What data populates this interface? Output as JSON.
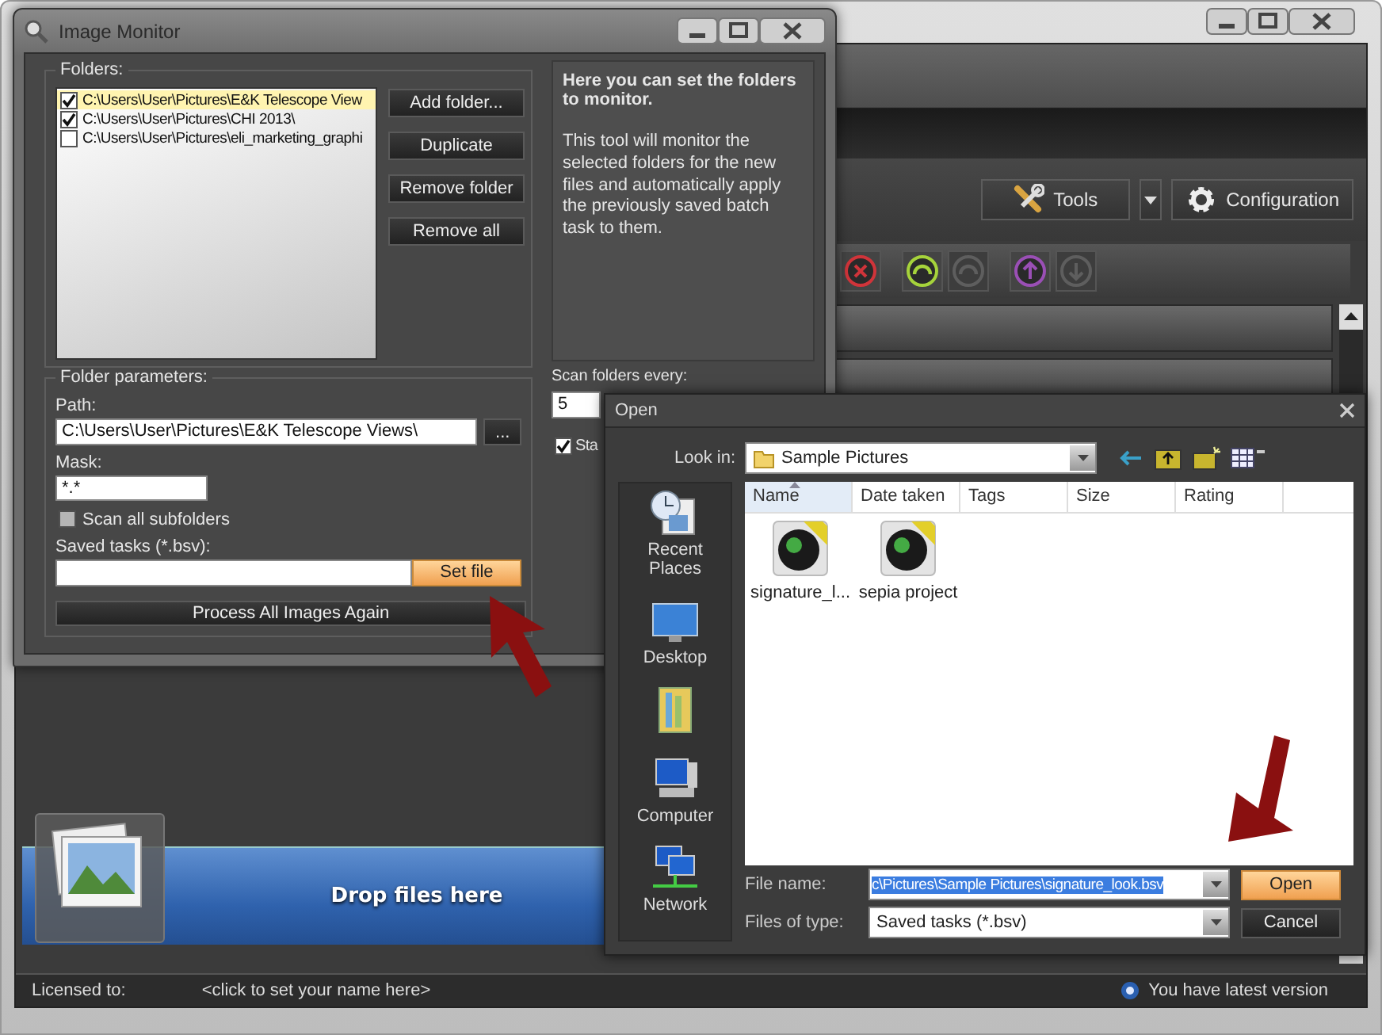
{
  "main_window": {
    "toolbar_buttons": [
      {
        "label": "Tools",
        "kind": "tools"
      },
      {
        "label": "Configuration",
        "kind": "configuration"
      }
    ],
    "action_buttons": [
      {
        "kind": "cancel",
        "disabled": false
      },
      {
        "kind": "up",
        "disabled": false
      },
      {
        "kind": "up",
        "disabled": true
      },
      {
        "kind": "upload",
        "disabled": false
      },
      {
        "kind": "download",
        "disabled": true
      }
    ],
    "drop_zone": {
      "label": "Drop files here"
    },
    "status_bar": {
      "license_label": "Licensed to:",
      "license_value": "<click to set your name here>",
      "update_status": "You have latest version"
    }
  },
  "image_monitor": {
    "title": "Image Monitor",
    "folders_label": "Folders:",
    "folders": [
      {
        "path": "C:\\Users\\User\\Pictures\\E&K Telescope View",
        "checked": true,
        "selected": true
      },
      {
        "path": "C:\\Users\\User\\Pictures\\CHI 2013\\",
        "checked": true,
        "selected": false
      },
      {
        "path": "C:\\Users\\User\\Pictures\\eli_marketing_graphi",
        "checked": false,
        "selected": false
      }
    ],
    "folder_buttons": [
      "Add folder...",
      "Duplicate",
      "Remove folder",
      "Remove all"
    ],
    "info_title": "Here you can set the folders to monitor.",
    "info_text": "This tool will monitor the selected folders for the new files and automatically apply the previously saved batch task to them.",
    "params_label": "Folder parameters:",
    "path_label": "Path:",
    "path_value": "C:\\Users\\User\\Pictures\\E&K Telescope Views\\",
    "browse_button": "...",
    "mask_label": "Mask:",
    "mask_value": "*.*",
    "scan_subfolders": {
      "label": "Scan all subfolders",
      "checked": false
    },
    "saved_tasks_label": "Saved tasks (*.bsv):",
    "set_file_button": "Set file",
    "process_button": "Process All Images Again",
    "scan_every_label": "Scan folders every:",
    "scan_every_value": "5",
    "start_option": {
      "label": "Sta",
      "checked": true
    }
  },
  "open_dialog": {
    "title": "Open",
    "look_in_label": "Look in:",
    "look_in_value": "Sample Pictures",
    "places": [
      {
        "kind": "recent",
        "label": "Recent Places"
      },
      {
        "kind": "desktop",
        "label": "Desktop"
      },
      {
        "kind": "libraries"
      },
      {
        "kind": "computer",
        "label": "Computer"
      },
      {
        "kind": "network",
        "label": "Network"
      }
    ],
    "columns": [
      {
        "label": "Name",
        "sorted": true
      },
      {
        "label": "Date taken",
        "sorted": false
      },
      {
        "label": "Tags",
        "sorted": false
      },
      {
        "label": "Size",
        "sorted": false
      },
      {
        "label": "Rating",
        "sorted": false
      }
    ],
    "files": [
      {
        "name": "signature_l..."
      },
      {
        "name": "sepia project"
      }
    ],
    "file_name_label": "File name:",
    "file_name": {
      "value": "c\\Pictures\\Sample Pictures\\signature_look.bsv",
      "text_selected": true
    },
    "file_type_label": "Files of type:",
    "file_type_value": "Saved tasks (*.bsv)",
    "buttons": [
      {
        "label": "Open",
        "kind": "default"
      },
      {
        "label": "Cancel",
        "kind": "normal"
      }
    ]
  }
}
